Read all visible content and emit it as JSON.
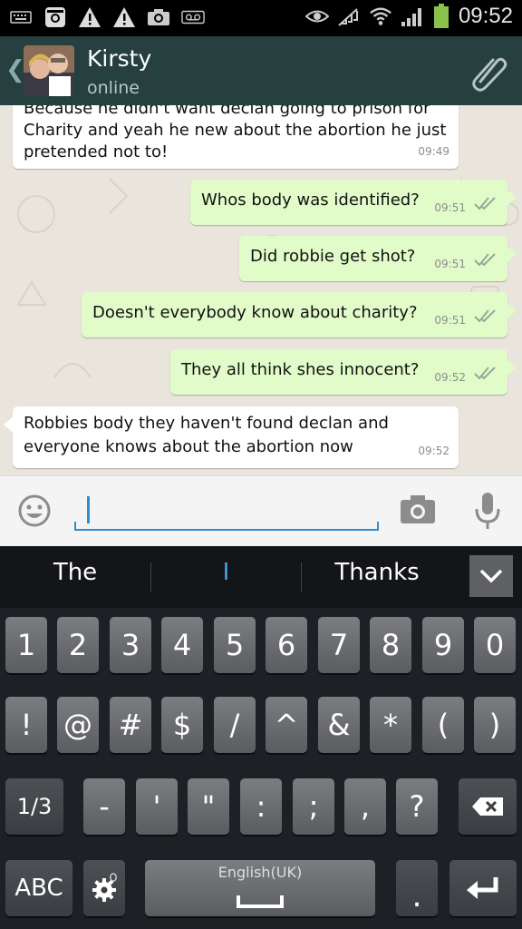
{
  "status_bar": {
    "left_icons": [
      "keyboard-icon",
      "instagram-icon",
      "warning-icon",
      "warning-icon",
      "camera-notification-icon",
      "voicemail-icon"
    ],
    "right_icons": [
      "eye-icon",
      "no-signal-icon",
      "wifi-icon",
      "signal-icon",
      "battery-icon"
    ],
    "time": "09:52"
  },
  "header": {
    "contact_name": "Kirsty",
    "status": "online"
  },
  "messages": [
    {
      "dir": "in",
      "text_line1": "Because he didn't want declan going to prison for",
      "text_line2": "Charity and yeah he new about the abortion he just",
      "text_line3": "pretended not to!",
      "time": "09:49"
    },
    {
      "dir": "out",
      "text": "Whos body was identified?",
      "time": "09:51"
    },
    {
      "dir": "out",
      "text": "Did robbie get shot?",
      "time": "09:51"
    },
    {
      "dir": "out",
      "text": "Doesn't everybody know about charity?",
      "time": "09:51"
    },
    {
      "dir": "out",
      "text": "They all think shes innocent?",
      "time": "09:52"
    },
    {
      "dir": "in",
      "text_line1": "Robbies body they haven't found declan and",
      "text_line2": "everyone knows about the abortion now",
      "time": "09:52"
    }
  ],
  "input": {
    "value": "",
    "placeholder": ""
  },
  "suggestions": [
    "The",
    "I",
    "Thanks"
  ],
  "keyboard": {
    "row1": [
      "1",
      "2",
      "3",
      "4",
      "5",
      "6",
      "7",
      "8",
      "9",
      "0"
    ],
    "row2": [
      "!",
      "@",
      "#",
      "$",
      "/",
      "^",
      "&",
      "*",
      "(",
      ")"
    ],
    "row3": [
      "1/3",
      "-",
      "'",
      "\"",
      ":",
      ";",
      ",",
      "?"
    ],
    "abc": "ABC",
    "space_label": "English(UK)"
  },
  "colors": {
    "header": "#25403f",
    "outgoing": "#e2fcc9",
    "incoming": "#ffffff",
    "accent": "#2e8fcf"
  }
}
